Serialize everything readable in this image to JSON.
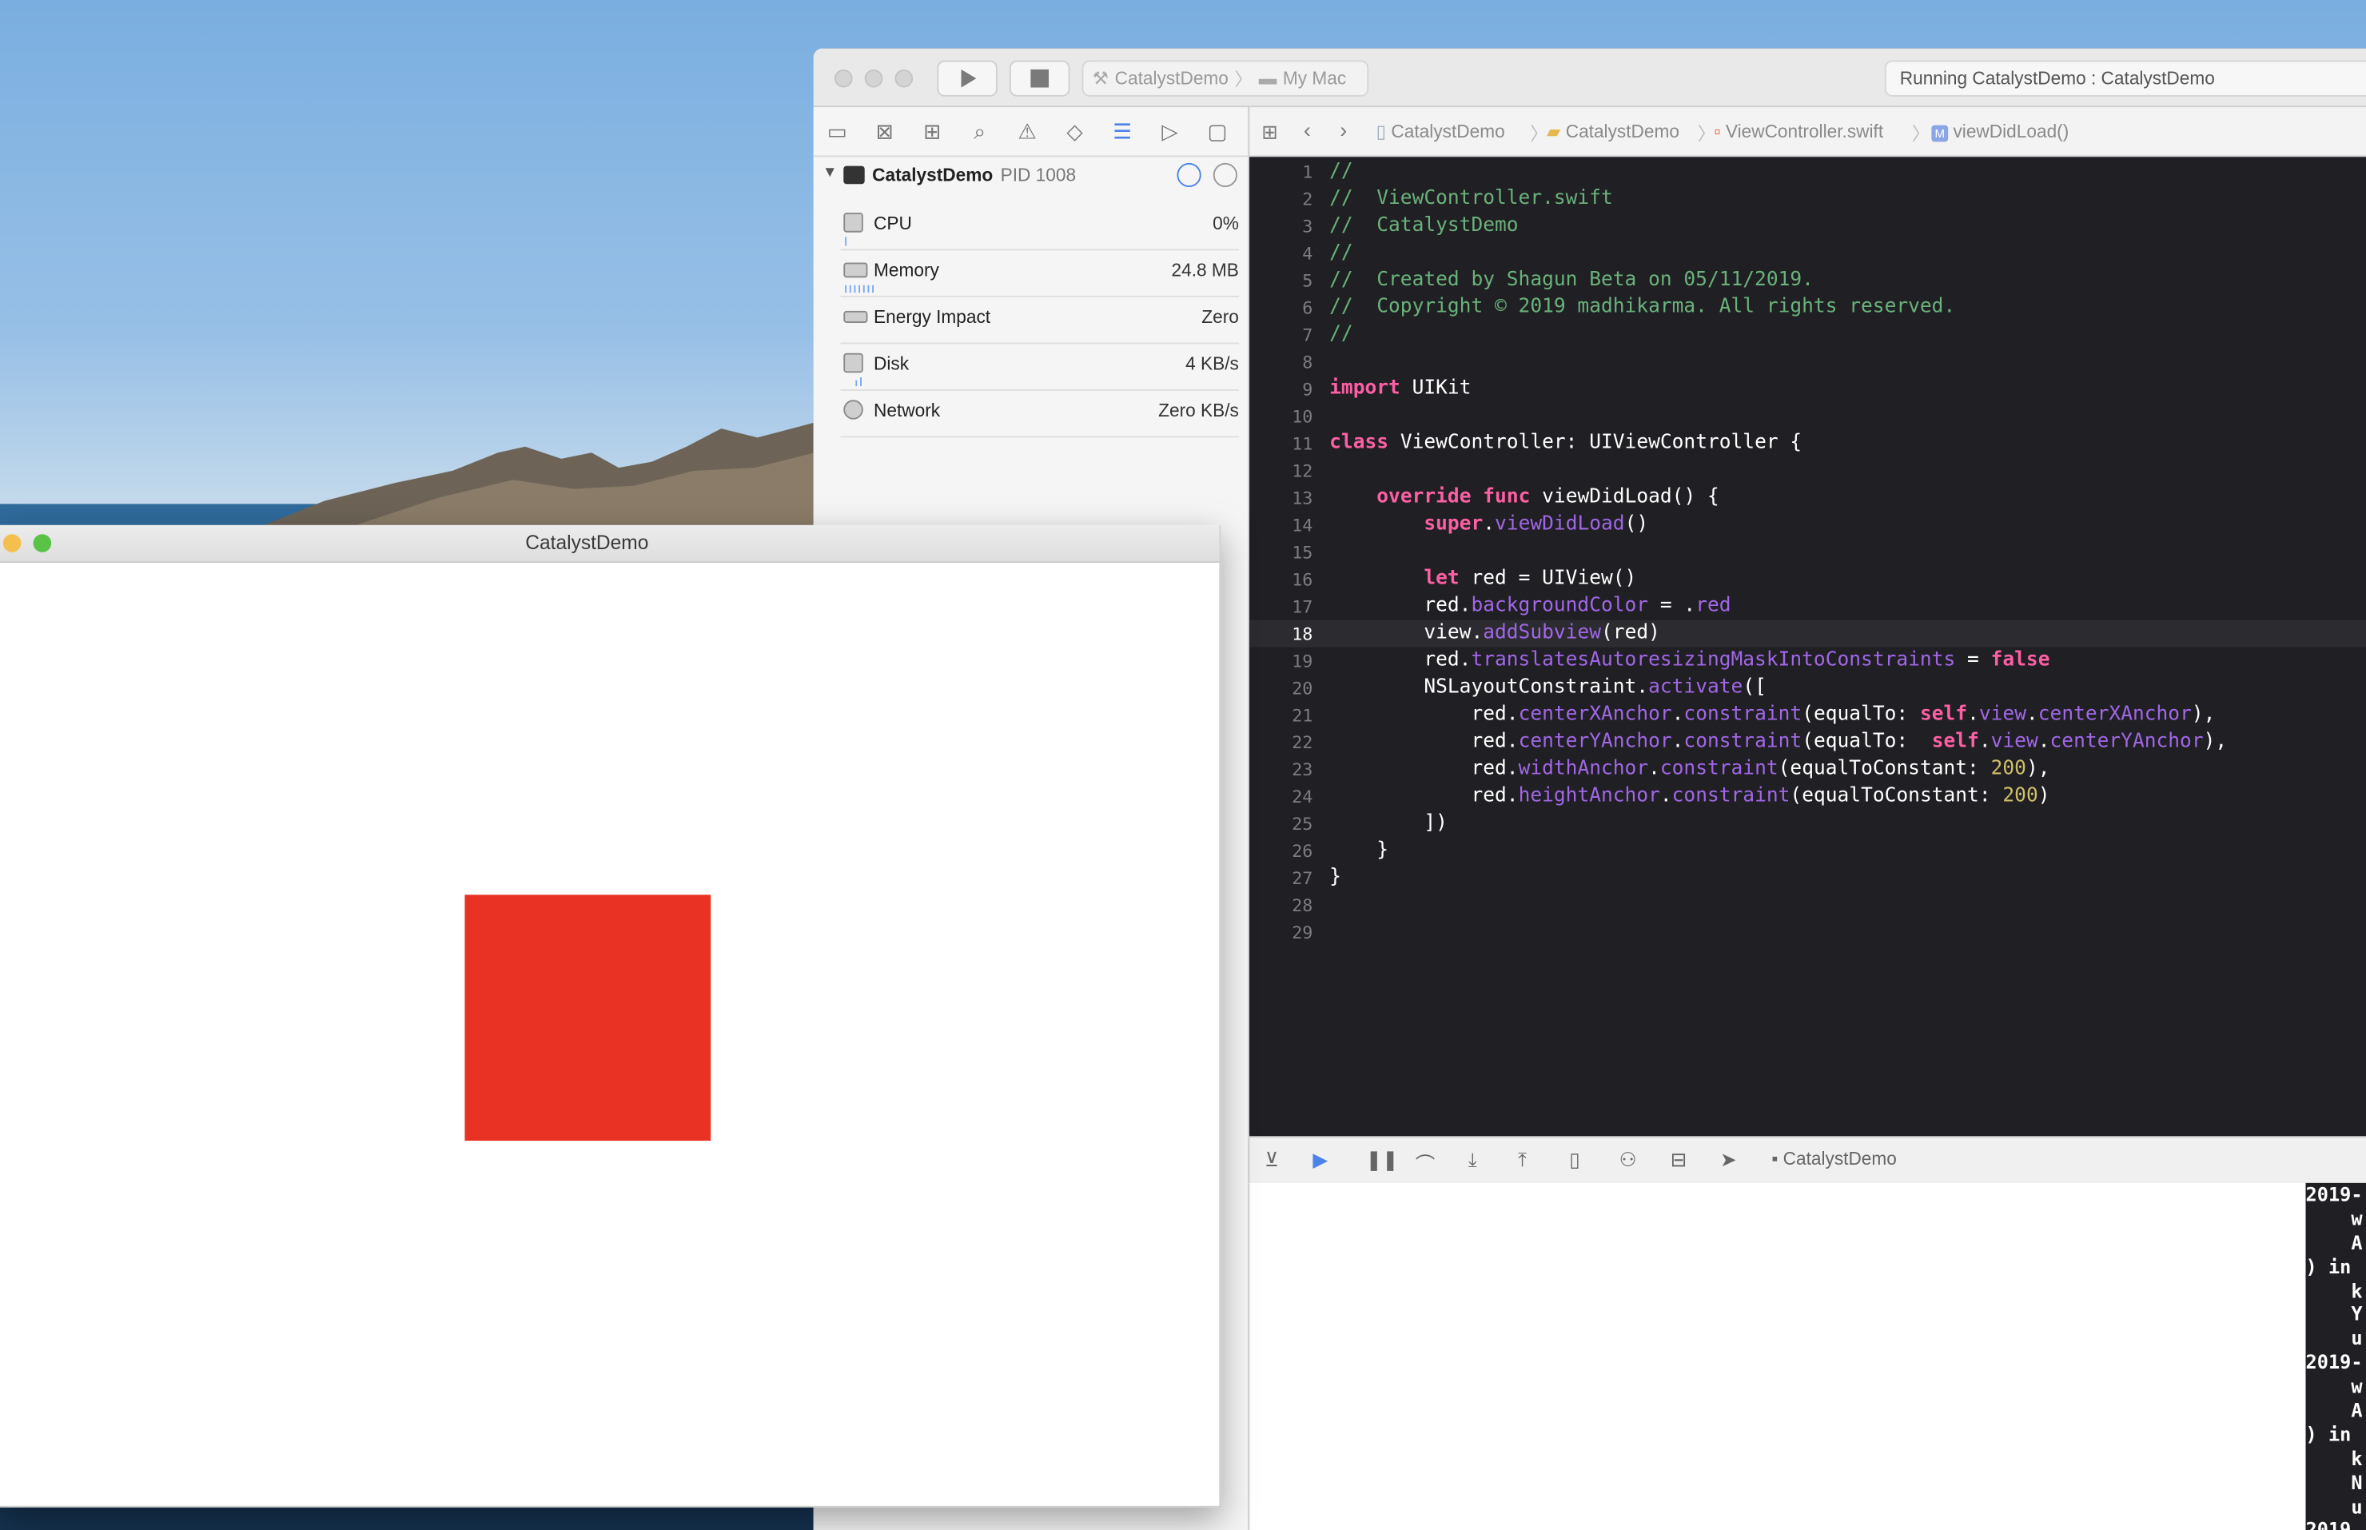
{
  "colors": {
    "accent": "#4c83e8",
    "red_view": "#e93223",
    "editor_bg": "#1f1f24",
    "comment": "#6ab27a",
    "keyword": "#fc5fa3"
  },
  "xcode": {
    "scheme_target": "CatalystDemo",
    "scheme_device": "My Mac",
    "activity_status": "Running CatalystDemo : CatalystDemo",
    "toolbar_icons": [
      "run-icon",
      "stop-icon"
    ],
    "navigator_icons": [
      "folder-icon",
      "source-control-icon",
      "symbol-icon",
      "search-icon",
      "warning-icon",
      "test-icon",
      "debug-icon",
      "breakpoint-icon",
      "report-icon"
    ],
    "process": {
      "name": "CatalystDemo",
      "pid": "PID 1008"
    },
    "gauges": [
      {
        "label": "CPU",
        "value": "0%"
      },
      {
        "label": "Memory",
        "value": "24.8 MB"
      },
      {
        "label": "Energy Impact",
        "value": "Zero"
      },
      {
        "label": "Disk",
        "value": "4 KB/s"
      },
      {
        "label": "Network",
        "value": "Zero KB/s"
      }
    ],
    "breadcrumb": [
      "CatalystDemo",
      "CatalystDemo",
      "ViewController.swift",
      "viewDidLoad()"
    ],
    "current_line": 18,
    "line_numbers": [
      "1",
      "2",
      "3",
      "4",
      "5",
      "6",
      "7",
      "8",
      "9",
      "10",
      "11",
      "12",
      "13",
      "14",
      "15",
      "16",
      "17",
      "18",
      "19",
      "20",
      "21",
      "22",
      "23",
      "24",
      "25",
      "26",
      "27",
      "28",
      "29"
    ],
    "code": [
      "//",
      "//  ViewController.swift",
      "//  CatalystDemo",
      "//",
      "//  Created by Shagun Beta on 05/11/2019.",
      "//  Copyright © 2019 madhikarma. All rights reserved.",
      "//",
      "",
      "import UIKit",
      "",
      "class ViewController: UIViewController {",
      "",
      "    override func viewDidLoad() {",
      "        super.viewDidLoad()",
      "",
      "        let red = UIView()",
      "        red.backgroundColor = .red",
      "        view.addSubview(red)",
      "        red.translatesAutoresizingMaskIntoConstraints = false",
      "        NSLayoutConstraint.activate([",
      "            red.centerXAnchor.constraint(equalTo: self.view.centerXAnchor),",
      "            red.centerYAnchor.constraint(equalTo:  self.view.centerYAnchor),",
      "            red.widthAnchor.constraint(equalToConstant: 200),",
      "            red.heightAnchor.constraint(equalToConstant: 200)",
      "        ])",
      "    }",
      "}",
      "",
      ""
    ],
    "debug_target": "CatalystDemo",
    "console_lines": [
      "2019-",
      "    w",
      "    A",
      ") in",
      "    k",
      "    Y",
      "    u",
      "2019-",
      "    w",
      "    A",
      ") in",
      "    k",
      "    N",
      "    u",
      "2019"
    ]
  },
  "app_window": {
    "title": "CatalystDemo"
  }
}
